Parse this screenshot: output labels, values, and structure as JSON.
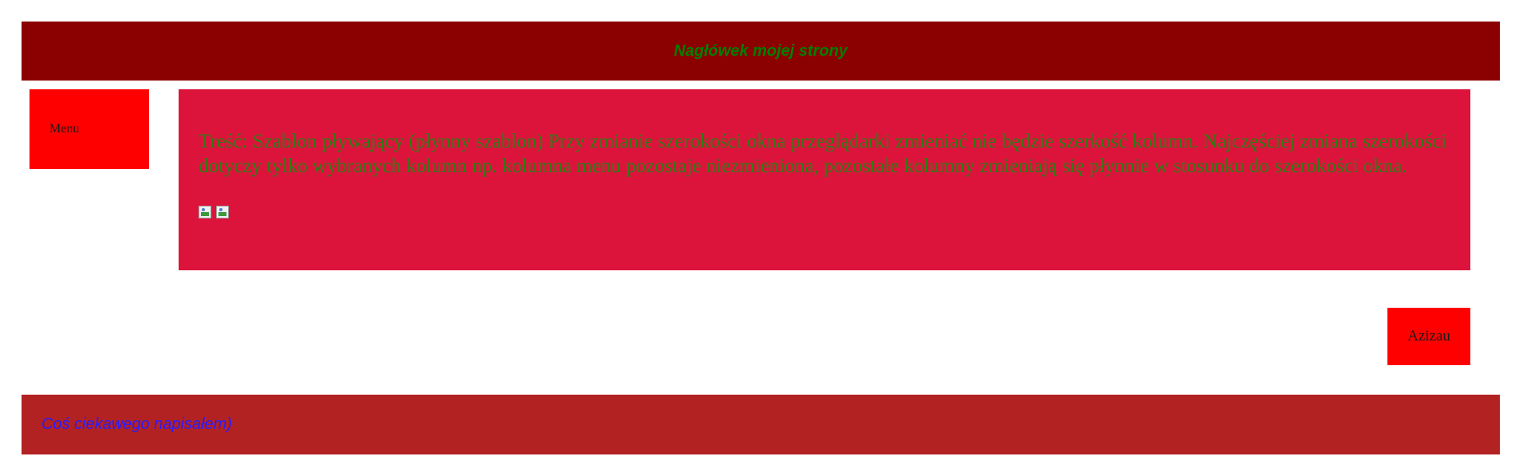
{
  "header": {
    "title": "Nagłówek mojej strony"
  },
  "menu": {
    "label": "Menu"
  },
  "content": {
    "text": "Treść: Szablon pływający (płynny szablon) Przy zmianie szerokości okna przeglądarki zmieniać nie będzie szerkość kolumn. Najczęściej zmiana szerokości dotyczy tylko wybranych kolumn np. kolumna menu pozostaje niezmieniona, pozostałe kolumny zmieniają się płynnie w stosunku do szerokości okna.",
    "images": [
      {
        "icon": "broken-image-icon"
      },
      {
        "icon": "broken-image-icon"
      }
    ]
  },
  "aside": {
    "label": "Azizau"
  },
  "footer": {
    "text": "Coś ciekawego napisałem)"
  },
  "colors": {
    "header_bg": "#8b0000",
    "header_text": "#008000",
    "menu_bg": "#ff0000",
    "content_bg": "#dc143c",
    "content_text": "#2e7d14",
    "aside_bg": "#ff0000",
    "footer_bg": "#b22222",
    "footer_text": "#2a1aff"
  }
}
